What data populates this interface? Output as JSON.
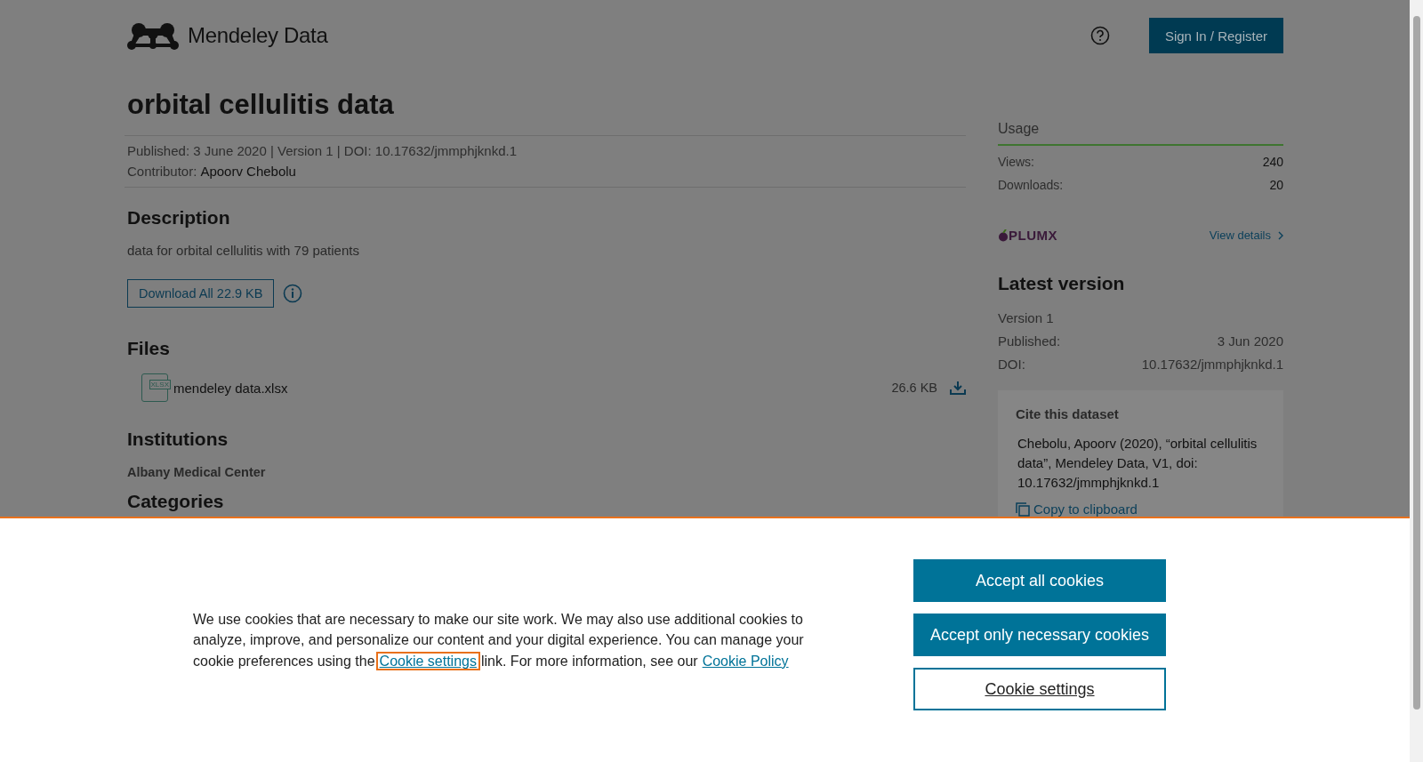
{
  "header": {
    "logo_text": "Mendeley Data",
    "sign_in": "Sign In / Register"
  },
  "dataset": {
    "title": "orbital cellulitis data",
    "meta": "Published: 3 June 2020 | Version 1 | DOI: 10.17632/jmmphjknkd.1",
    "contributor_label": "Contributor:",
    "contributor": "Apoorv Chebolu"
  },
  "description": {
    "heading": "Description",
    "text": "data for orbital cellulitis with 79 patients",
    "download_button": "Download All 22.9 KB"
  },
  "files": {
    "heading": "Files",
    "items": [
      {
        "name": "mendeley data.xlsx",
        "size": "26.6 KB",
        "badge": "XLSX"
      }
    ]
  },
  "institutions": {
    "heading": "Institutions",
    "items": [
      "Albany Medical Center"
    ]
  },
  "categories": {
    "heading": "Categories"
  },
  "usage": {
    "title": "Usage",
    "rows": [
      {
        "label": "Views:",
        "value": "240"
      },
      {
        "label": "Downloads:",
        "value": "20"
      }
    ],
    "plumx": "PLUMX",
    "view_details": "View details"
  },
  "latest_version": {
    "heading": "Latest version",
    "version": "Version 1",
    "rows": [
      {
        "label": "Published:",
        "value": "3 Jun 2020"
      },
      {
        "label": "DOI:",
        "value": "10.17632/jmmphjknkd.1"
      }
    ],
    "cite": {
      "heading": "Cite this dataset",
      "text": "Chebolu, Apoorv (2020), “orbital cellulitis data”, Mendeley Data, V1, doi: 10.17632/jmmphjknkd.1",
      "copy": "Copy to clipboard"
    }
  },
  "cookie_banner": {
    "text_before": "We use cookies that are necessary to make our site work. We may also use additional cookies to analyze, improve, and personalize our content and your digital experience. You can manage your cookie preferences using the",
    "link": {
      "text": "Cookie settings",
      "focused": true
    },
    "text_middle": "link. For more information, see our",
    "policy_link": {
      "text": "Cookie Policy",
      "focused": false
    },
    "buttons": [
      {
        "label": "Accept all cookies",
        "kind": "primary"
      },
      {
        "label": "Accept only necessary cookies",
        "kind": "primary"
      },
      {
        "label": "Cookie settings",
        "kind": "secondary"
      }
    ]
  }
}
